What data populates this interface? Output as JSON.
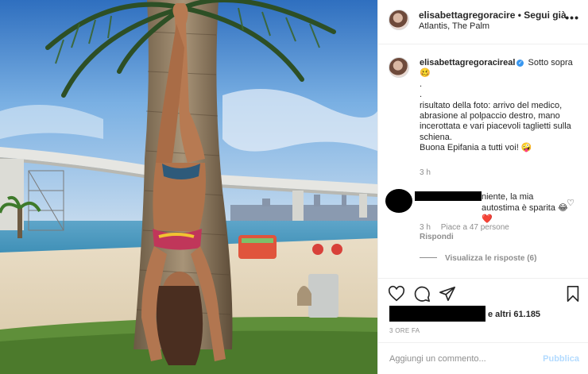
{
  "post": {
    "author": "elisabettagregoracire",
    "follow_label": "• Segui già",
    "location": "Atlantis, The Palm",
    "more_icon": "more-icon"
  },
  "caption": {
    "author": "elisabettagregoracireal",
    "verified_icon": "verified-badge-icon",
    "lines": [
      "Sotto sopra 🥴",
      ".",
      ".",
      "risultato della foto: arrivo del medico, abrasione al polpaccio destro, mano incerottata e vari piacevoli taglietti sulla schiena.",
      "Buona Epifania a tutti voi! 🤪"
    ],
    "time": "3 h"
  },
  "comment": {
    "text": "niente, la mia autostima è sparita 😂❤️",
    "time": "3 h",
    "likes": "Piace a 47 persone",
    "reply": "Rispondi",
    "view_replies": "Visualizza le risposte (6)"
  },
  "actions": {
    "icons": [
      "heart-icon",
      "comment-icon",
      "share-icon",
      "bookmark-icon"
    ],
    "likes_text": "e altri 61.185",
    "age": "3 ORE FA"
  },
  "add_comment": {
    "placeholder": "Aggiungi un commento...",
    "publish": "Pubblica"
  },
  "colors": {
    "link_disabled": "#b3dbff",
    "muted": "#8e8e8e",
    "verified": "#3897f0"
  }
}
